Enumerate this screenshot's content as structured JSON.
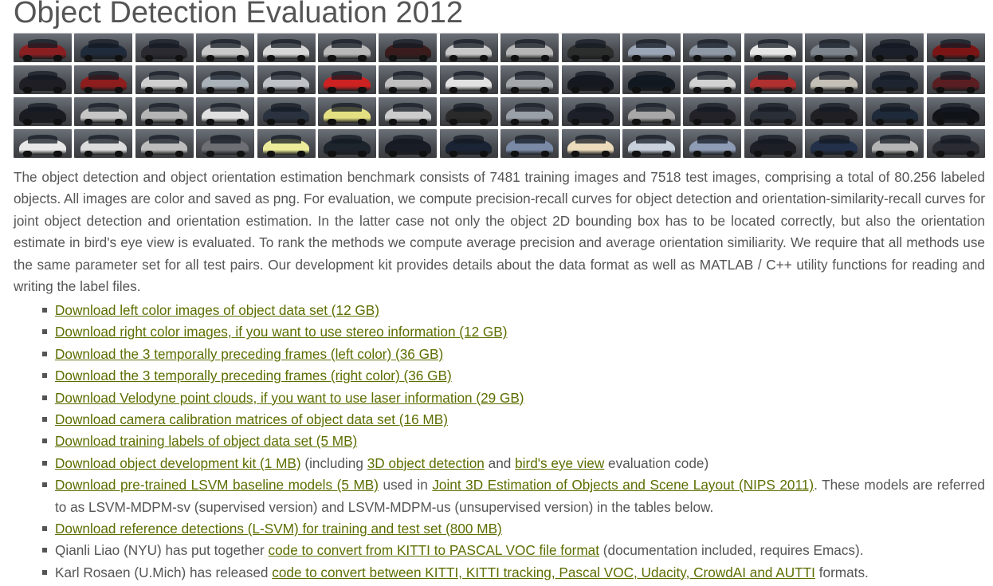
{
  "title": "Object Detection Evaluation 2012",
  "mosaic": {
    "rows": 4,
    "cols": 16,
    "tiles": [
      "#8a1f22",
      "#1f2a3a",
      "#2a2a30",
      "#c9c9c9",
      "#d7d7d7",
      "#b9b9b9",
      "#3a1c1c",
      "#c8c8c8",
      "#b6b6b6",
      "#2c2d2d",
      "#9aa5b5",
      "#8f99a6",
      "#e6e6e6",
      "#7d848c",
      "#1b1f2a",
      "#7b1515",
      "#1e1e24",
      "#8e1d1d",
      "#cfcfcf",
      "#a9b1b9",
      "#bfc3c7",
      "#cc2222",
      "#c0c0c0",
      "#e2e2e2",
      "#a5a8ab",
      "#15191f",
      "#121820",
      "#d2d2d2",
      "#b03030",
      "#c4c0b7",
      "#1f2530",
      "#5a1e22",
      "#1a1c22",
      "#c6c6c6",
      "#b5b5b5",
      "#e0e0e0",
      "#2a3240",
      "#e4e082",
      "#cccccc",
      "#2a2a2a",
      "#9aa0a8",
      "#1d2028",
      "#a7a7a7",
      "#222228",
      "#2a2e36",
      "#202024",
      "#1e2a3a",
      "#101418",
      "#e8e8e8",
      "#dcdcdc",
      "#bdbdbd",
      "#6e6f74",
      "#ecec9a",
      "#1e242c",
      "#181c24",
      "#1a2434",
      "#7a8aa6",
      "#ecdcbc",
      "#c9d1dd",
      "#8e9cb6",
      "#1c1f25",
      "#22304a",
      "#b5b5b5",
      "#2a2c33"
    ]
  },
  "description": "The object detection and object orientation estimation benchmark consists of 7481 training images and 7518 test images, comprising a total of 80.256 labeled objects. All images are color and saved as png. For evaluation, we compute precision-recall curves for object detection and orientation-similarity-recall curves for joint object detection and orientation estimation. In the latter case not only the object 2D bounding box has to be located correctly, but also the orientation estimate in bird's eye view is evaluated. To rank the methods we compute average precision and average orientation similiarity. We require that all methods use the same parameter set for all test pairs. Our development kit provides details about the data format as well as MATLAB / C++ utility functions for reading and writing the label files.",
  "downloads": {
    "left_color": "Download left color images of object data set (12 GB)",
    "right_color": "Download right color images, if you want to use stereo information (12 GB)",
    "prev_left": "Download the 3 temporally preceding frames (left color) (36 GB)",
    "prev_right": "Download the 3 temporally preceding frames (right color) (36 GB)",
    "velodyne": "Download Velodyne point clouds, if you want to use laser information (29 GB)",
    "calib": "Download camera calibration matrices of object data set (16 MB)",
    "labels": "Download training labels of object data set (5 MB)",
    "devkit": {
      "link": "Download object development kit (1 MB)",
      "text1": " (including ",
      "link_3d": "3D object detection",
      "text2": " and ",
      "link_bev": "bird's eye view",
      "text3": " evaluation code)"
    },
    "lsvm": {
      "link": "Download pre-trained LSVM baseline models (5 MB)",
      "text1": " used in ",
      "link_paper": "Joint 3D Estimation of Objects and Scene Layout (NIPS 2011)",
      "text2": ". These models are referred to as LSVM-MDPM-sv (supervised version) and LSVM-MDPM-us (unsupervised version) in the tables below."
    },
    "refdet": "Download reference detections (L-SVM) for training and test set (800 MB)",
    "qianli": {
      "text1": "Qianli Liao (NYU) has put together ",
      "link": "code to convert from KITTI to PASCAL VOC file format",
      "text2": " (documentation included, requires Emacs)."
    },
    "karl": {
      "text1": "Karl Rosaen (U.Mich) has released ",
      "link": "code to convert between KITTI, KITTI tracking, Pascal VOC, Udacity, CrowdAI and AUTTI",
      "text2": " formats."
    }
  },
  "colors": {
    "text": "#555555",
    "link": "#5c6e00"
  }
}
